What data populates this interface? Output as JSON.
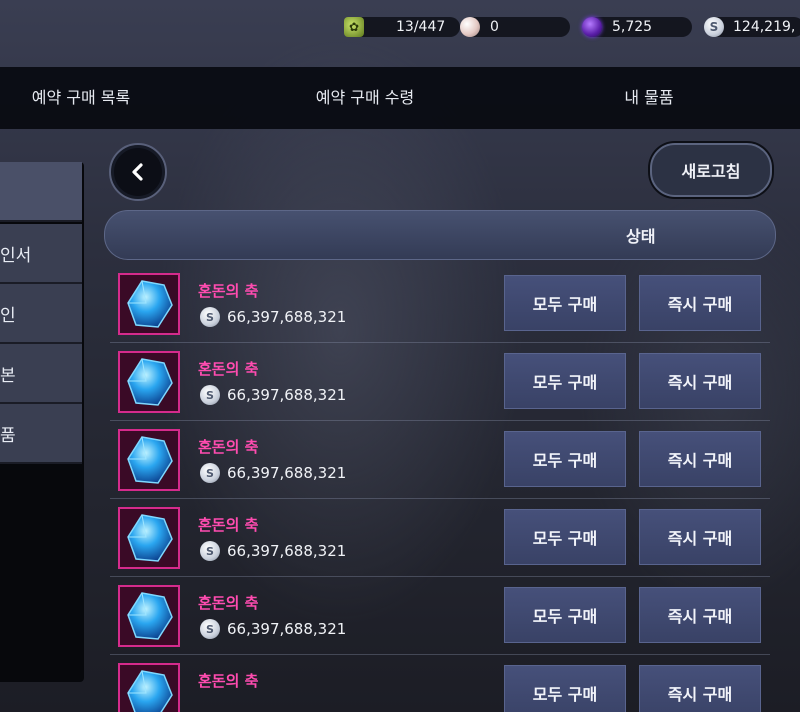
{
  "currencies": [
    {
      "icon": "leaf-icon",
      "value": "13/447"
    },
    {
      "icon": "pearl-icon",
      "value": "0"
    },
    {
      "icon": "purple-orb-icon",
      "value": "5,725"
    },
    {
      "icon": "silver-coin-icon",
      "value": "124,219,"
    }
  ],
  "tabs": [
    "예약 구매 목록",
    "예약 구매 수령",
    "내 물품"
  ],
  "side_menu": [
    "",
    "인서",
    "인",
    "본",
    "품"
  ],
  "refresh_label": "새로고침",
  "status_header": "상태",
  "items": [
    {
      "name": "혼돈의 축",
      "price": "66,397,688,321",
      "buy_all": "모두 구매",
      "buy_now": "즉시 구매"
    },
    {
      "name": "혼돈의 축",
      "price": "66,397,688,321",
      "buy_all": "모두 구매",
      "buy_now": "즉시 구매"
    },
    {
      "name": "혼돈의 축",
      "price": "66,397,688,321",
      "buy_all": "모두 구매",
      "buy_now": "즉시 구매"
    },
    {
      "name": "혼돈의 축",
      "price": "66,397,688,321",
      "buy_all": "모두 구매",
      "buy_now": "즉시 구매"
    },
    {
      "name": "혼돈의 축",
      "price": "66,397,688,321",
      "buy_all": "모두 구매",
      "buy_now": "즉시 구매"
    },
    {
      "name": "혼돈의 축",
      "price": "",
      "buy_all": "모두 구매",
      "buy_now": "즉시 구매"
    }
  ],
  "colors": {
    "item_name": "#ff4cb0",
    "accent_button": "#46507a",
    "thumb_border": "#d52b8c"
  }
}
